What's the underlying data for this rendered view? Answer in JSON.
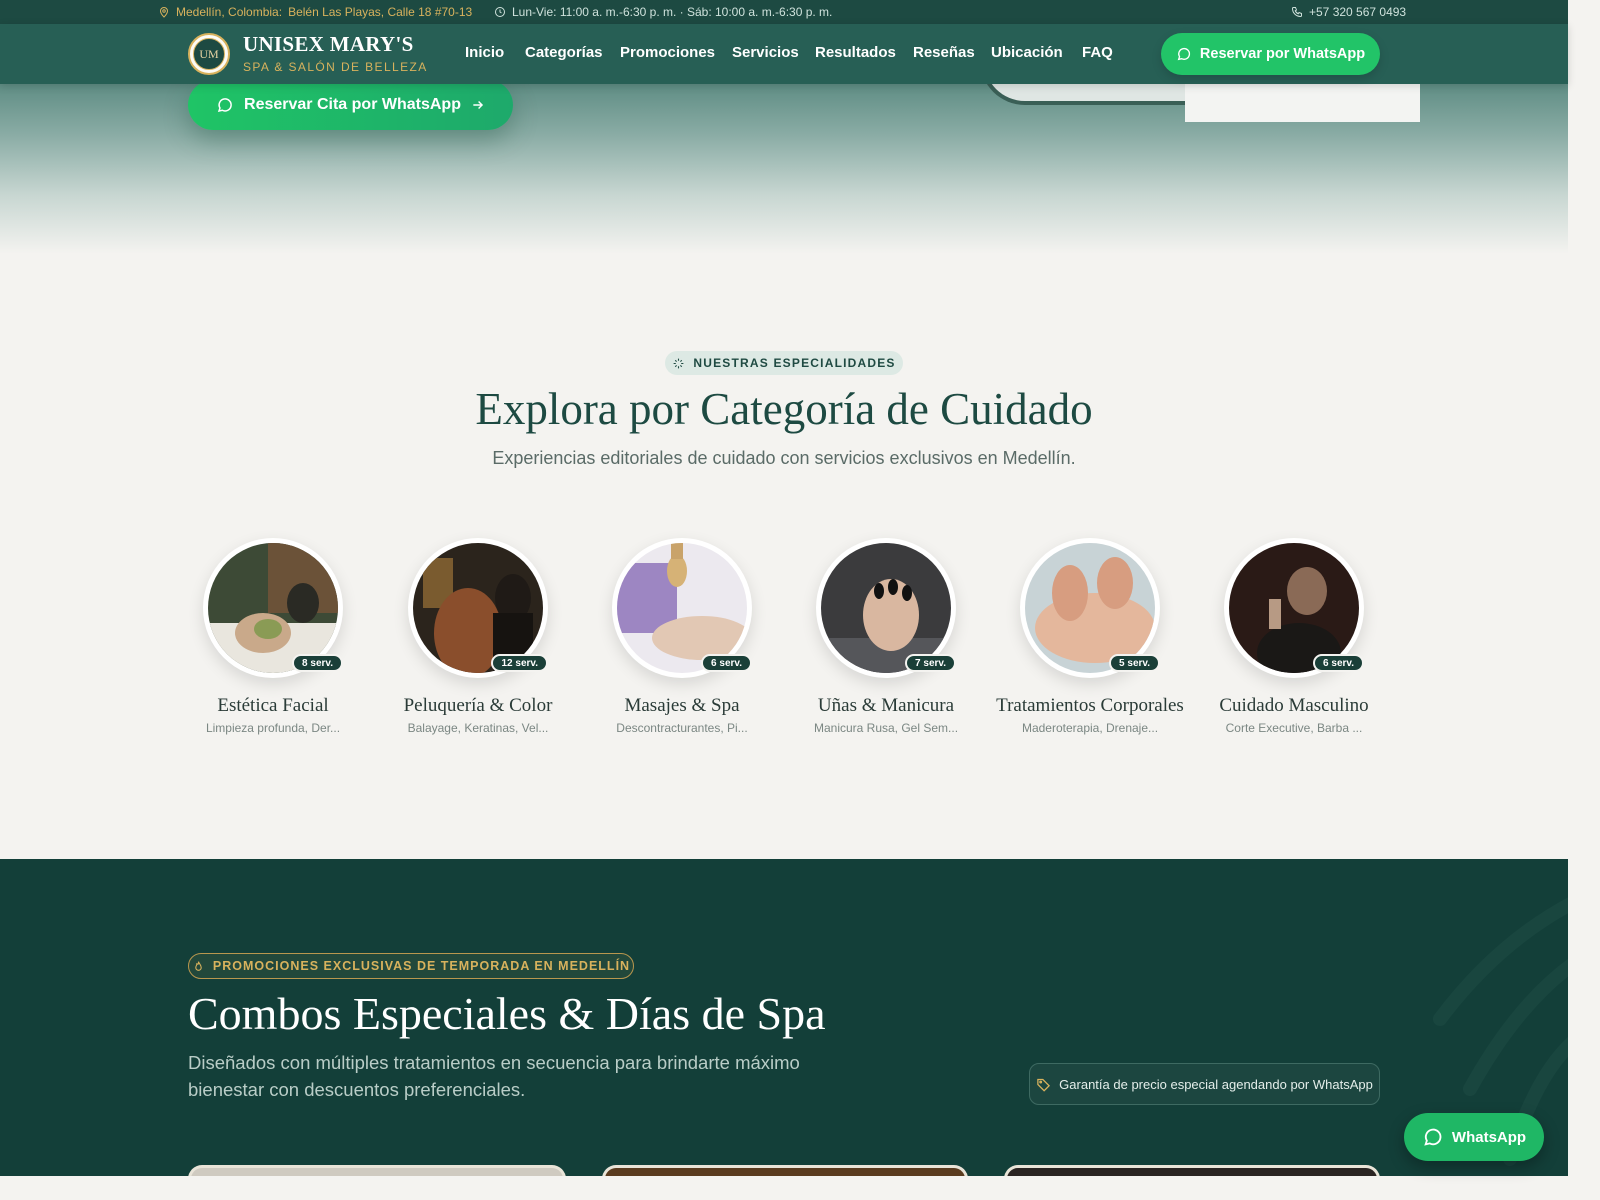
{
  "topbar": {
    "city": "Medellín, Colombia:",
    "address": "Belén Las Playas, Calle 18 #70-13",
    "hours": "Lun-Vie: 11:00 a. m.-6:30 p. m. · Sáb: 10:00 a. m.-6:30 p. m.",
    "phone": "+57 320 567 0493"
  },
  "brand": {
    "monogram": "UM",
    "name": "UNISEX MARY'S",
    "tagline": "SPA & SALÓN DE BELLEZA"
  },
  "nav": {
    "items": [
      "Inicio",
      "Categorías",
      "Promociones",
      "Servicios",
      "Resultados",
      "Reseñas",
      "Ubicación",
      "FAQ"
    ],
    "cta": "Reservar por WhatsApp"
  },
  "hero": {
    "cta": "Reservar Cita por WhatsApp"
  },
  "categories": {
    "badge": "NUESTRAS ESPECIALIDADES",
    "title": "Explora por Categoría de Cuidado",
    "subtitle": "Experiencias editoriales de cuidado con servicios exclusivos en Medellín.",
    "items": [
      {
        "name": "Estética Facial",
        "count": "8 serv.",
        "desc": "Limpieza profunda, Der..."
      },
      {
        "name": "Peluquería & Color",
        "count": "12 serv.",
        "desc": "Balayage, Keratinas, Vel..."
      },
      {
        "name": "Masajes & Spa",
        "count": "6 serv.",
        "desc": "Descontracturantes, Pi..."
      },
      {
        "name": "Uñas & Manicura",
        "count": "7 serv.",
        "desc": "Manicura Rusa, Gel Sem..."
      },
      {
        "name": "Tratamientos Corporales",
        "count": "5 serv.",
        "desc": "Maderoterapia, Drenaje..."
      },
      {
        "name": "Cuidado Masculino",
        "count": "6 serv.",
        "desc": "Corte Executive, Barba ..."
      }
    ]
  },
  "promotions": {
    "badge": "PROMOCIONES EXCLUSIVAS DE TEMPORADA EN MEDELLÍN",
    "title": "Combos Especiales & Días de Spa",
    "subtitle": "Diseñados con múltiples tratamientos en secuencia para brindarte máximo bienestar con descuentos preferenciales.",
    "guarantee": "Garantía de precio especial agendando por WhatsApp"
  },
  "whatsapp_float": {
    "label": "WhatsApp"
  },
  "colors": {
    "brand_dark": "#1d4a42",
    "nav_bg": "#275f55",
    "gold": "#d8b25d",
    "whatsapp_green": "#22c468",
    "promo_bg": "#133f39",
    "page_bg": "#f4f3f0"
  }
}
